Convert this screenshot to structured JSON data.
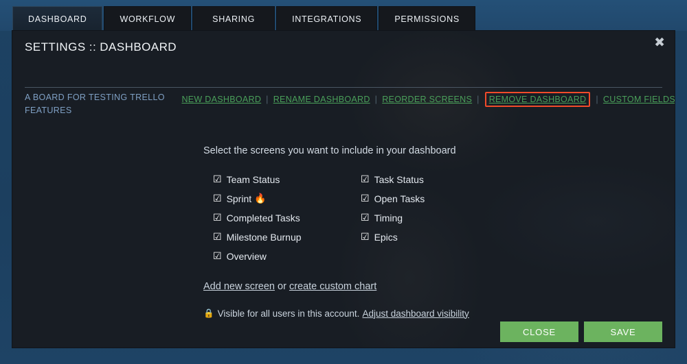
{
  "tabs": [
    {
      "label": "DASHBOARD",
      "active": true
    },
    {
      "label": "WORKFLOW",
      "active": false
    },
    {
      "label": "SHARING",
      "active": false
    },
    {
      "label": "INTEGRATIONS",
      "active": false
    },
    {
      "label": "PERMISSIONS",
      "active": false
    }
  ],
  "modal": {
    "title": "SETTINGS :: DASHBOARD",
    "subtitle": "A BOARD FOR TESTING TRELLO FEATURES",
    "close_icon": "✖",
    "action_links": [
      {
        "label": "NEW DASHBOARD",
        "highlighted": false
      },
      {
        "label": "RENAME DASHBOARD",
        "highlighted": false
      },
      {
        "label": "REORDER SCREENS",
        "highlighted": false
      },
      {
        "label": "REMOVE DASHBOARD",
        "highlighted": true
      },
      {
        "label": "CUSTOM FIELDS",
        "highlighted": false
      }
    ],
    "separator": "|",
    "prompt": "Select the screens you want to include in your dashboard",
    "checkbox_glyph": "☑",
    "columns": [
      {
        "items": [
          {
            "label": "Team Status",
            "checked": true,
            "emoji": ""
          },
          {
            "label": "Sprint",
            "checked": true,
            "emoji": "🔥"
          },
          {
            "label": "Completed Tasks",
            "checked": true,
            "emoji": ""
          },
          {
            "label": "Milestone Burnup",
            "checked": true,
            "emoji": ""
          },
          {
            "label": "Overview",
            "checked": true,
            "emoji": ""
          }
        ]
      },
      {
        "items": [
          {
            "label": "Task Status",
            "checked": true,
            "emoji": ""
          },
          {
            "label": "Open Tasks",
            "checked": true,
            "emoji": ""
          },
          {
            "label": "Timing",
            "checked": true,
            "emoji": ""
          },
          {
            "label": "Epics",
            "checked": true,
            "emoji": ""
          }
        ]
      }
    ],
    "add_row": {
      "add_link": "Add new screen",
      "conjunction": " or ",
      "chart_link": "create custom chart"
    },
    "visibility": {
      "lock_icon": "🔒",
      "text": "Visible for all users in this account.",
      "link": "Adjust dashboard visibility"
    },
    "footer": {
      "close_label": "CLOSE",
      "save_label": "SAVE"
    }
  },
  "colors": {
    "page_background": "#1e4264",
    "modal_background": "#181d24",
    "tab_inactive": "#15181d",
    "tab_active": "#1d2b3a",
    "link_green": "#4aa05a",
    "highlight_red": "#f24b2a",
    "button_green": "#6cb35f",
    "subtitle_blue": "#7fa0c4"
  }
}
